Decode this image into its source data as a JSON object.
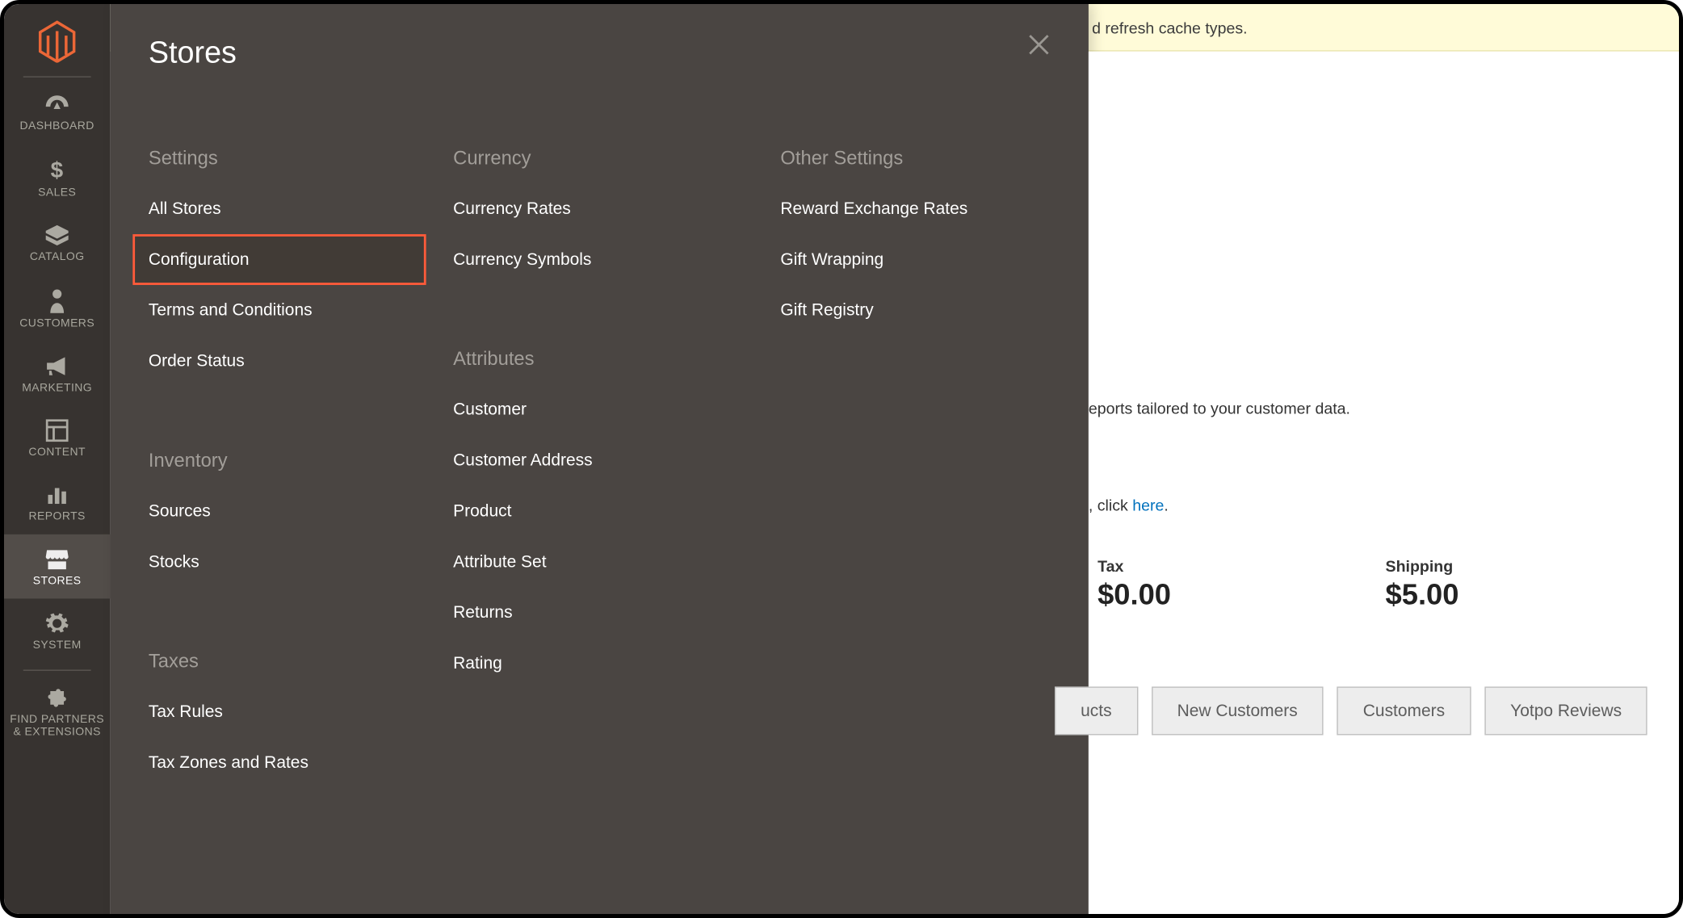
{
  "sidebar": {
    "items": [
      {
        "label": "DASHBOARD"
      },
      {
        "label": "SALES"
      },
      {
        "label": "CATALOG"
      },
      {
        "label": "CUSTOMERS"
      },
      {
        "label": "MARKETING"
      },
      {
        "label": "CONTENT"
      },
      {
        "label": "REPORTS"
      },
      {
        "label": "STORES"
      },
      {
        "label": "SYSTEM"
      },
      {
        "label": "FIND PARTNERS\n& EXTENSIONS"
      }
    ]
  },
  "banner": {
    "partial_text": "d refresh cache types."
  },
  "subpanel": {
    "title": "Stores",
    "settings": {
      "heading": "Settings",
      "items": [
        "All Stores",
        "Configuration",
        "Terms and Conditions",
        "Order Status"
      ]
    },
    "inventory": {
      "heading": "Inventory",
      "items": [
        "Sources",
        "Stocks"
      ]
    },
    "taxes": {
      "heading": "Taxes",
      "items": [
        "Tax Rules",
        "Tax Zones and Rates"
      ]
    },
    "currency": {
      "heading": "Currency",
      "items": [
        "Currency Rates",
        "Currency Symbols"
      ]
    },
    "attributes": {
      "heading": "Attributes",
      "items": [
        "Customer",
        "Customer Address",
        "Product",
        "Attribute Set",
        "Returns",
        "Rating"
      ]
    },
    "other": {
      "heading": "Other Settings",
      "items": [
        "Reward Exchange Rates",
        "Gift Wrapping",
        "Gift Registry"
      ]
    }
  },
  "content": {
    "partial_reports": "eports tailored to your customer data.",
    "partial_click": ", click ",
    "here": "here",
    "period": ".",
    "kpis": [
      {
        "label": "Tax",
        "value": "$0.00"
      },
      {
        "label": "Shipping",
        "value": "$5.00"
      }
    ],
    "tabs": [
      "ucts",
      "New Customers",
      "Customers",
      "Yotpo Reviews"
    ]
  }
}
